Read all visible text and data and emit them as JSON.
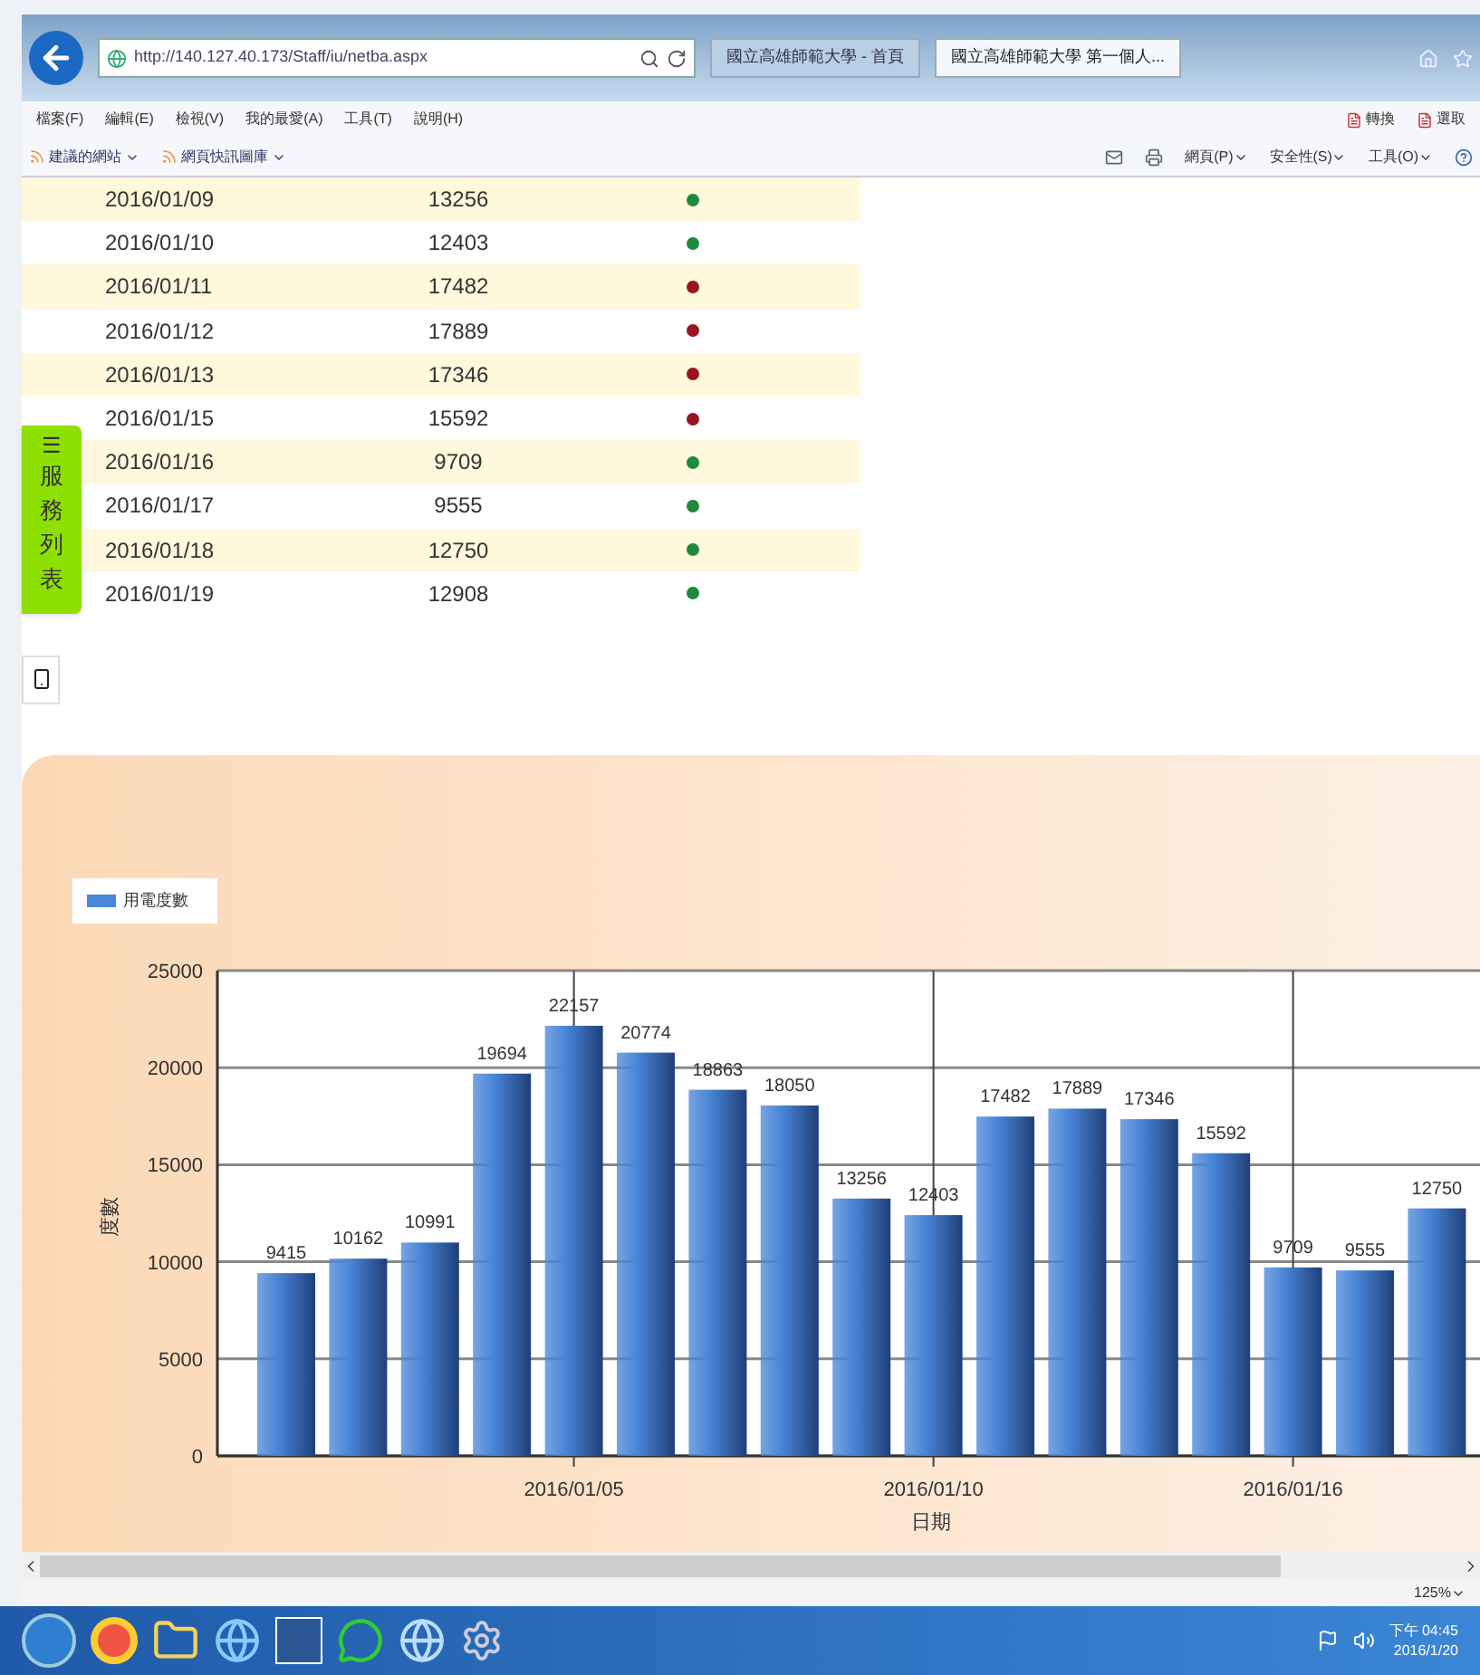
{
  "browser": {
    "address": "http://140.127.40.173/Staff/iu/netba.aspx",
    "tabs": [
      {
        "label": "國立高雄師範大學 - 首頁",
        "selected": false
      },
      {
        "label": "國立高雄師範大學 第一個人...",
        "selected": true
      }
    ],
    "menu": [
      "檔案(F)",
      "編輯(E)",
      "檢視(V)",
      "我的最愛(A)",
      "工具(T)",
      "說明(H)"
    ],
    "menu_right": [
      "轉換",
      "選取"
    ],
    "favorites": [
      "建議的網站",
      "網頁快訊圖庫"
    ],
    "commands": [
      "網頁(P)",
      "安全性(S)",
      "工具(O)"
    ]
  },
  "table": {
    "rows": [
      {
        "date": "2016/01/09",
        "value": "13256",
        "color": "#1e8a3c"
      },
      {
        "date": "2016/01/10",
        "value": "12403",
        "color": "#1e8a3c"
      },
      {
        "date": "2016/01/11",
        "value": "17482",
        "color": "#9a1424"
      },
      {
        "date": "2016/01/12",
        "value": "17889",
        "color": "#9a1424"
      },
      {
        "date": "2016/01/13",
        "value": "17346",
        "color": "#9a1424"
      },
      {
        "date": "2016/01/15",
        "value": "15592",
        "color": "#9a1424"
      },
      {
        "date": "2016/01/16",
        "value": "9709",
        "color": "#1e8a3c"
      },
      {
        "date": "2016/01/17",
        "value": "9555",
        "color": "#1e8a3c"
      },
      {
        "date": "2016/01/18",
        "value": "12750",
        "color": "#1e8a3c"
      },
      {
        "date": "2016/01/19",
        "value": "12908",
        "color": "#1e8a3c"
      }
    ]
  },
  "side_tab": {
    "icon": "☰",
    "label": "服務列表"
  },
  "chart": {
    "chart_data": {
      "type": "bar",
      "xlabel": "日期",
      "ylabel": "度數",
      "categories": [
        null,
        null,
        null,
        null,
        "2016/01/05",
        null,
        null,
        null,
        null,
        "2016/01/10",
        null,
        null,
        null,
        null,
        "2016/01/16",
        null,
        null
      ],
      "series": [
        {
          "name": "用電度數",
          "color": "#4a86d8",
          "values": [
            9415,
            10162,
            10991,
            19694,
            22157,
            20774,
            18863,
            18050,
            13256,
            12403,
            17482,
            17889,
            17346,
            15592,
            9709,
            9555,
            12750
          ]
        }
      ],
      "ylim": [
        0,
        25000
      ],
      "yticks": [
        0,
        5000,
        10000,
        15000,
        20000,
        25000
      ],
      "grid": true,
      "data_labels": true
    }
  },
  "status_bar": {
    "zoom": "125%"
  },
  "taskbar": {
    "time": "下午 04:45",
    "date": "2016/1/20"
  }
}
